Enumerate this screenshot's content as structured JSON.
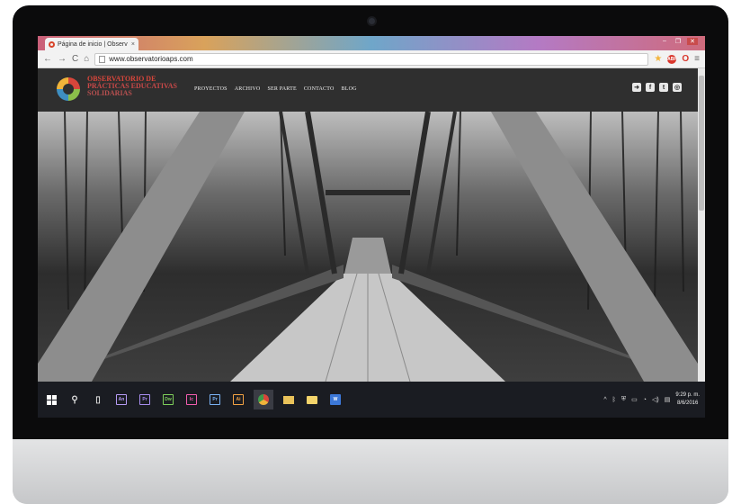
{
  "browser": {
    "tab_title": "Página de inicio | Observ",
    "tab_close": "×",
    "window_controls": [
      "–",
      "❐",
      "✕"
    ],
    "back": "←",
    "forward": "→",
    "reload": "C",
    "home": "⌂",
    "url": "www.observatorioaps.com"
  },
  "site": {
    "logo_lines": [
      "OBSERVATORIO DE",
      "PRÁCTICAS EDUCATIVAS",
      "SOLIDARIAS"
    ],
    "nav": [
      "PROYECTOS",
      "ARCHIVO",
      "SER PARTE",
      "CONTACTO",
      "BLOG"
    ],
    "social_icons": [
      "login-icon",
      "facebook-icon",
      "twitter-icon",
      "instagram-icon"
    ],
    "hero_image": "bridge-photo"
  },
  "taskbar": {
    "apps": [
      {
        "name": "start-button",
        "label": ""
      },
      {
        "name": "search-icon",
        "label": "⚲"
      },
      {
        "name": "task-view-icon",
        "label": "▯"
      },
      {
        "name": "animate-app",
        "label": "An",
        "color": "#b69bf5"
      },
      {
        "name": "premiere-app",
        "label": "Pr",
        "color": "#a88ef0"
      },
      {
        "name": "dreamweaver-app",
        "label": "Dw",
        "color": "#7fcf5a"
      },
      {
        "name": "incopy-app",
        "label": "Ic",
        "color": "#f25dae"
      },
      {
        "name": "premiere-pro-app",
        "label": "Pr",
        "color": "#7bb3f5"
      },
      {
        "name": "illustrator-app",
        "label": "Ai",
        "color": "#f3a243"
      },
      {
        "name": "chrome-app",
        "label": "",
        "color": "#e0b33f"
      },
      {
        "name": "explorer-app",
        "label": "",
        "color": "#e9c25a"
      },
      {
        "name": "folder-app",
        "label": "",
        "color": "#f3d46b"
      },
      {
        "name": "word-app",
        "label": "W",
        "color": "#3c78d8"
      }
    ],
    "tray": {
      "time": "9:29 p. m.",
      "date": "8/6/2016"
    }
  }
}
